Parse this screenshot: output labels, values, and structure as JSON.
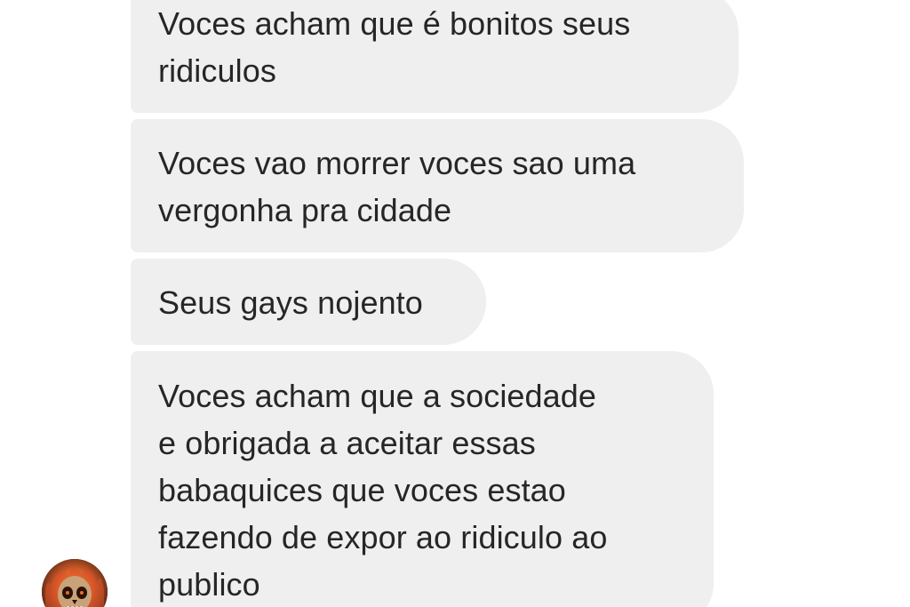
{
  "conversation": {
    "messages": [
      {
        "text": "Voces acham que é bonitos seus\nridiculos"
      },
      {
        "text": "Voces vao morrer voces sao uma\nvergonha pra cidade"
      },
      {
        "text": "Seus gays nojento"
      },
      {
        "text": "Voces acham que a sociedade\ne obrigada a aceitar essas\nbabaquices que voces estao\nfazendo de expor ao ridiculo ao\npublico"
      }
    ],
    "sender": {
      "avatar_icon": "skull-avatar-icon"
    }
  },
  "colors": {
    "bubble_background": "#efefef",
    "text": "#262626",
    "background": "#ffffff"
  }
}
